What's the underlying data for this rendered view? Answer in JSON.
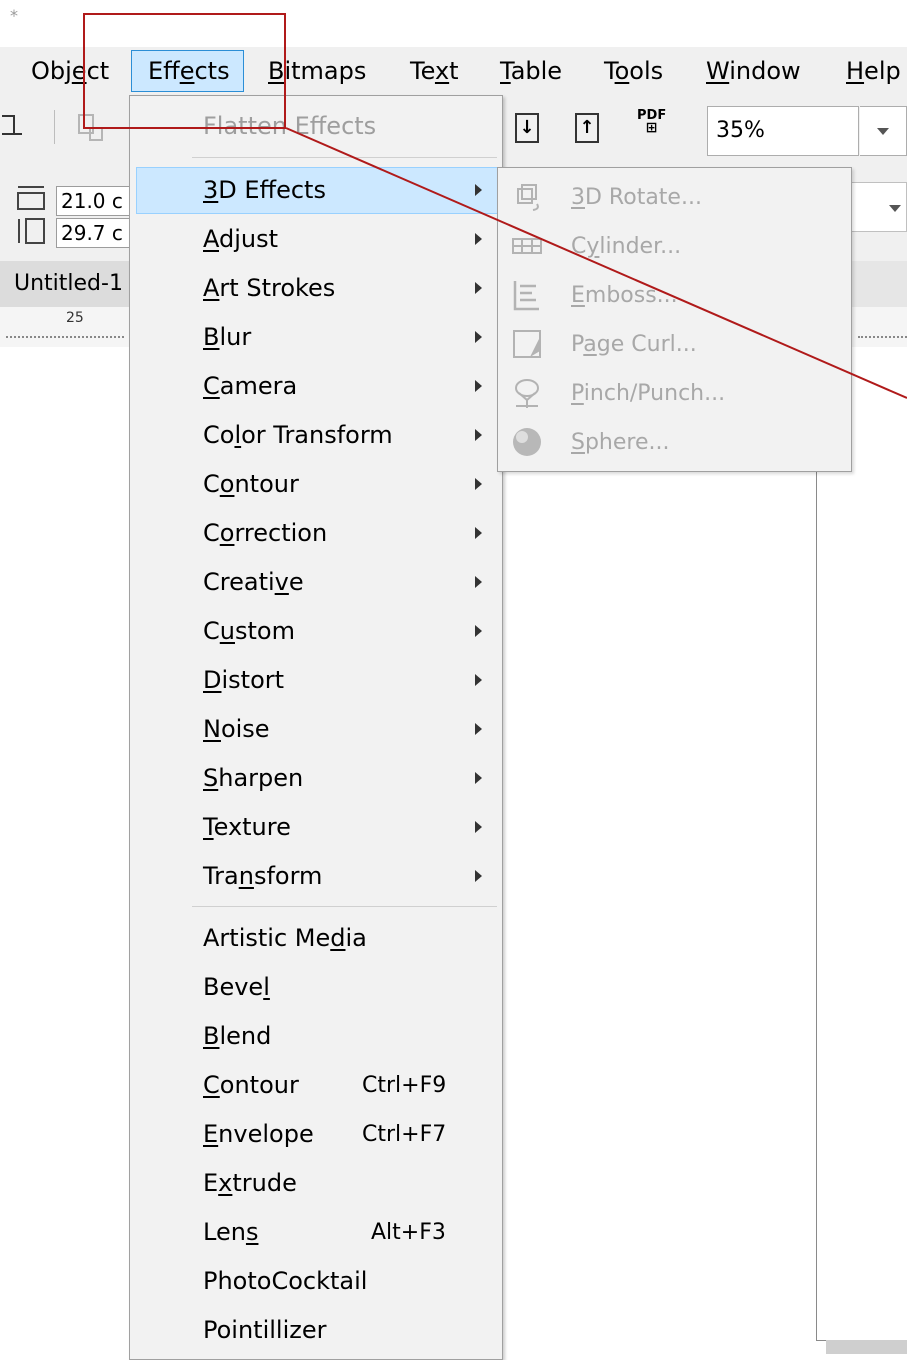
{
  "title_marker": "*",
  "menubar": {
    "items": [
      "Object",
      "Effects",
      "Bitmaps",
      "Text",
      "Table",
      "Tools",
      "Window",
      "Help"
    ]
  },
  "toolbar": {
    "import_icon": "import-icon",
    "export_icon": "export-icon",
    "pdf_label": "PDF",
    "zoom_value": "35%"
  },
  "propbar": {
    "width_value": "21.0 c",
    "height_value": "29.7 c"
  },
  "document_tab": "Untitled-1",
  "ruler": {
    "label": "25"
  },
  "effects_menu": {
    "top_item": "Flatten Effects",
    "submenu_items": [
      "3D Effects",
      "Adjust",
      "Art Strokes",
      "Blur",
      "Camera",
      "Color Transform",
      "Contour",
      "Correction",
      "Creative",
      "Custom",
      "Distort",
      "Noise",
      "Sharpen",
      "Texture",
      "Transform"
    ],
    "command_items": [
      {
        "label": "Artistic Media",
        "shortcut": ""
      },
      {
        "label": "Bevel",
        "shortcut": ""
      },
      {
        "label": "Blend",
        "shortcut": ""
      },
      {
        "label": "Contour",
        "shortcut": "Ctrl+F9"
      },
      {
        "label": "Envelope",
        "shortcut": "Ctrl+F7"
      },
      {
        "label": "Extrude",
        "shortcut": ""
      },
      {
        "label": "Lens",
        "shortcut": "Alt+F3"
      },
      {
        "label": "PhotoCocktail",
        "shortcut": ""
      },
      {
        "label": "Pointillizer",
        "shortcut": ""
      }
    ]
  },
  "submenu_3d": {
    "items": [
      {
        "label": "3D Rotate...",
        "icon": "3d-rotate-icon"
      },
      {
        "label": "Cylinder...",
        "icon": "cylinder-icon"
      },
      {
        "label": "Emboss...",
        "icon": "emboss-icon"
      },
      {
        "label": "Page Curl...",
        "icon": "page-curl-icon"
      },
      {
        "label": "Pinch/Punch...",
        "icon": "pinch-punch-icon"
      },
      {
        "label": "Sphere...",
        "icon": "sphere-icon"
      }
    ]
  },
  "colors": {
    "highlight": "#cce8ff",
    "highlight_border": "#99d1ff",
    "disabled_text": "#a8a8a8",
    "annotation": "#b01a1a"
  }
}
